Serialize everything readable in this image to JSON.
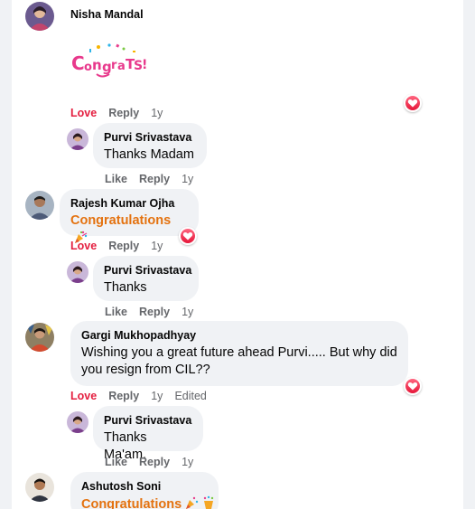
{
  "comments": [
    {
      "author": "Nisha Mandal",
      "avatar_icon": "nisha-avatar",
      "sticker_text": "Congrats!",
      "actions": {
        "love": "Love",
        "reply": "Reply",
        "time": "1y"
      },
      "reaction_icon": "heart-icon",
      "reply": {
        "author": "Purvi Srivastava",
        "text": "Thanks Madam",
        "actions": {
          "like": "Like",
          "reply": "Reply",
          "time": "1y"
        }
      }
    },
    {
      "author": "Rajesh Kumar Ojha",
      "text": "Congratulations",
      "text_emoji": "party-popper",
      "actions": {
        "love": "Love",
        "reply": "Reply",
        "time": "1y"
      },
      "reaction_icon": "heart-icon",
      "reply": {
        "author": "Purvi Srivastava",
        "text": "Thanks",
        "actions": {
          "like": "Like",
          "reply": "Reply",
          "time": "1y"
        }
      }
    },
    {
      "author": "Gargi Mukhopadhyay",
      "text_line1": "Wishing you a great future ahead Purvi..... But why did",
      "text_line2": "you resign from CIL??",
      "actions": {
        "love": "Love",
        "reply": "Reply",
        "time": "1y",
        "edited": "Edited"
      },
      "reaction_icon": "heart-icon",
      "reply": {
        "author": "Purvi Srivastava",
        "text": "Thanks Ma'am.",
        "actions": {
          "like": "Like",
          "reply": "Reply",
          "time": "1y"
        }
      }
    },
    {
      "author": "Ashutosh Soni",
      "text": "Congratulations",
      "text_emoji": "party-popper-confetti"
    }
  ],
  "colors": {
    "love": "#e41e3f",
    "congrats_text": "#e4720f",
    "bubble_bg": "#f0f2f5",
    "meta_gray": "#65676b"
  }
}
